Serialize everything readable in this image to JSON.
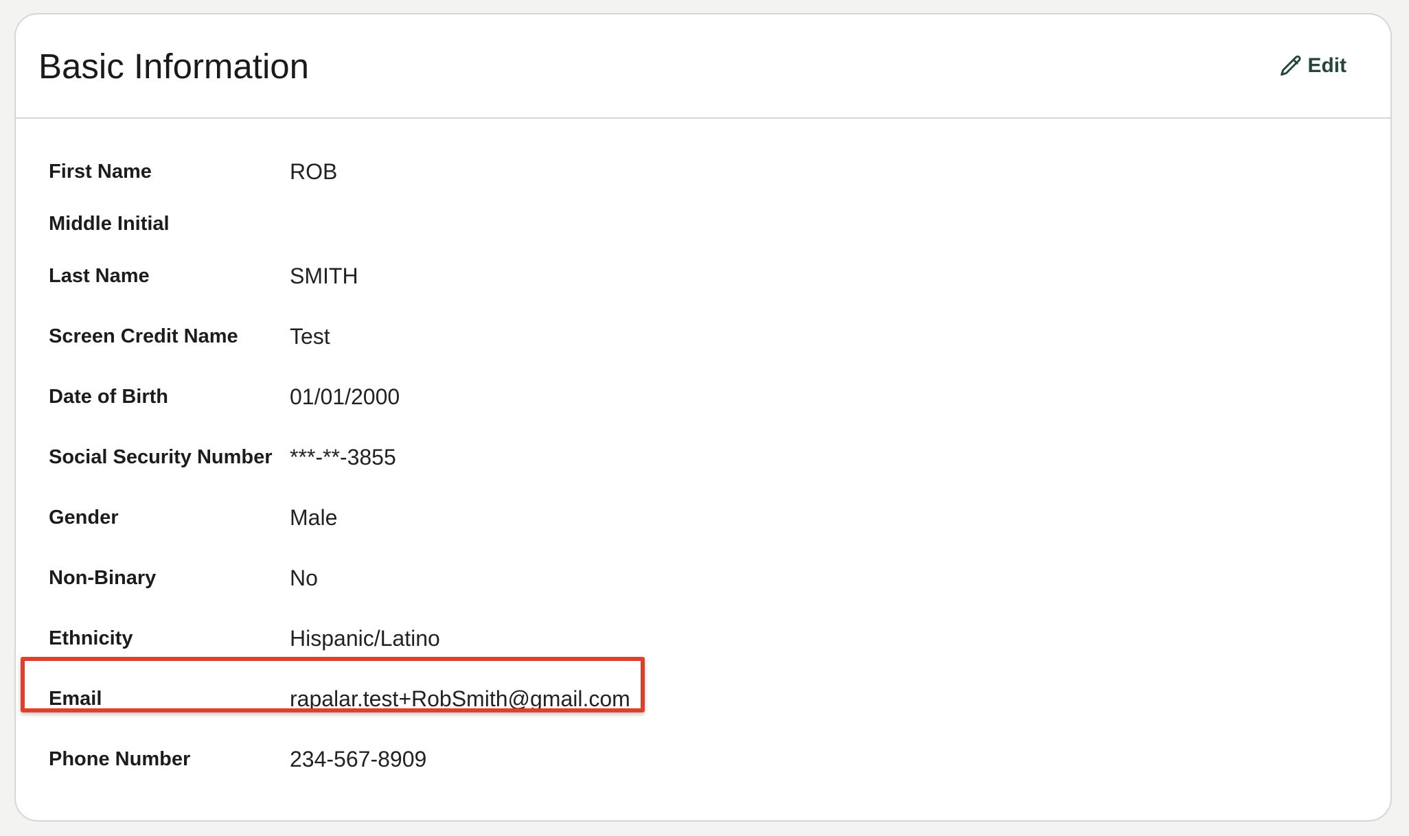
{
  "header": {
    "title": "Basic Information",
    "edit_label": "Edit",
    "edit_icon": "pencil-icon",
    "edit_color": "#25463d"
  },
  "fields": [
    {
      "label": "First Name",
      "value": "ROB"
    },
    {
      "label": "Middle Initial",
      "value": ""
    },
    {
      "label": "Last Name",
      "value": "SMITH"
    },
    {
      "label": "Screen Credit Name",
      "value": "Test"
    },
    {
      "label": "Date of Birth",
      "value": "01/01/2000"
    },
    {
      "label": "Social Security Number",
      "value": "***-**-3855"
    },
    {
      "label": "Gender",
      "value": "Male"
    },
    {
      "label": "Non-Binary",
      "value": "No"
    },
    {
      "label": "Ethnicity",
      "value": "Hispanic/Latino"
    },
    {
      "label": "Email",
      "value": "rapalar.test+RobSmith@gmail.com"
    },
    {
      "label": "Phone Number",
      "value": "234-567-8909"
    }
  ],
  "highlight": {
    "field": "Email",
    "color": "#e0402a"
  }
}
